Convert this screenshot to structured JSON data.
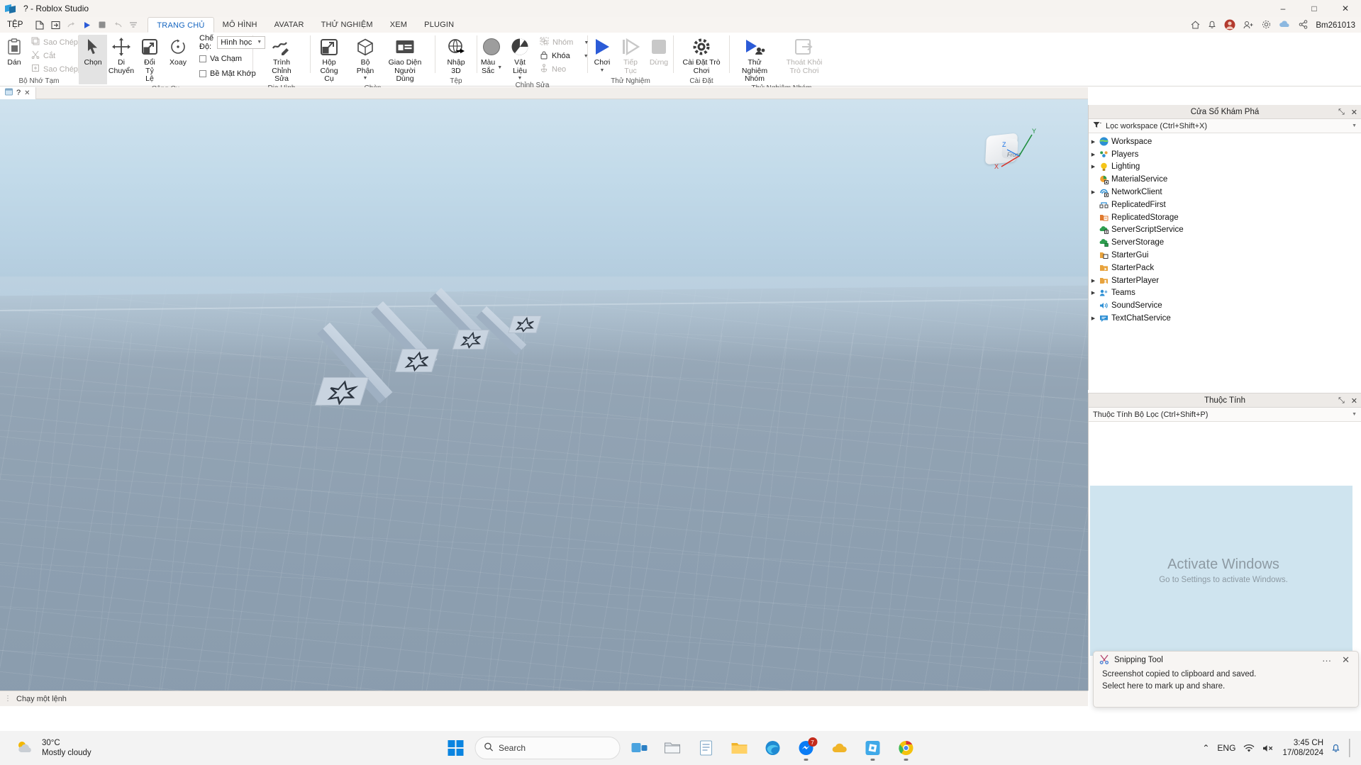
{
  "window": {
    "title": "? - Roblox Studio",
    "minimize": "–",
    "maximize": "□",
    "close": "✕"
  },
  "menu": {
    "file": "TỆP"
  },
  "quick_access": [
    {
      "name": "new-file-icon",
      "tooltip": "New"
    },
    {
      "name": "open-file-icon",
      "tooltip": "Open"
    },
    {
      "name": "redo-icon",
      "tooltip": "Redo"
    },
    {
      "name": "play-icon",
      "tooltip": "Play"
    },
    {
      "name": "stop-icon",
      "tooltip": "Stop"
    },
    {
      "name": "undo-icon",
      "tooltip": "Undo"
    },
    {
      "name": "customize-icon",
      "tooltip": "Customize"
    }
  ],
  "ribbon_tabs": [
    {
      "label": "TRANG CHỦ",
      "active": true
    },
    {
      "label": "MÔ HÌNH",
      "active": false
    },
    {
      "label": "AVATAR",
      "active": false
    },
    {
      "label": "THỬ NGHIỆM",
      "active": false
    },
    {
      "label": "XEM",
      "active": false
    },
    {
      "label": "PLUGIN",
      "active": false
    }
  ],
  "ribbon": {
    "groups": [
      {
        "label": "Bộ Nhớ Tạm",
        "paste": "Dán",
        "copy": "Sao Chép",
        "cut": "Cắt",
        "duplicate": "Sao Chép"
      },
      {
        "label": "Công Cụ",
        "select": "Chọn",
        "move": "Di Chuyển",
        "scale": "Đổi Tỷ\nLệ",
        "rotate": "Xoay",
        "mode_label": "Chế Độ:",
        "mode_value": "Hình học",
        "collisions": "Va Chạm",
        "join_surfaces": "Bề Mặt Khớp"
      },
      {
        "label": "Địa Hình",
        "editor": "Trình Chỉnh\nSửa"
      },
      {
        "label": "Chèn",
        "toolbox": "Hộp Công\nCụ",
        "part": "Bộ Phận",
        "ui": "Giao Diện\nNgười Dùng"
      },
      {
        "label": "Tệp",
        "import3d": "Nhập\n3D"
      },
      {
        "label": "Chỉnh Sửa",
        "color": "Màu\nSắc",
        "material": "Vật Liệu",
        "group": "Nhóm",
        "lock": "Khóa",
        "anchor": "Neo"
      },
      {
        "label": "Thử Nghiệm",
        "play": "Chơi",
        "resume": "Tiếp\nTục",
        "stop": "Dừng"
      },
      {
        "label": "Cài Đặt",
        "game_settings": "Cài Đặt Trò\nChơi"
      },
      {
        "label": "Thử Nghiệm Nhóm",
        "team_test": "Thử Nghiệm\nNhóm",
        "leave_game": "Thoát Khỏi\nTrò Chơi"
      }
    ]
  },
  "account_bar": {
    "user": "Bm261013",
    "icons": [
      "home-icon",
      "notification-bell-icon",
      "avatar-icon",
      "add-person-icon",
      "settings-gear-icon",
      "cloud-icon",
      "share-icon"
    ]
  },
  "viewport_tab": {
    "label": "?",
    "close": "✕"
  },
  "viewcube": {
    "front_label": "Front",
    "axis_x": "X",
    "axis_y": "Y",
    "axis_z": "Z",
    "color_x": "#d93025",
    "color_y": "#1e8e3e",
    "color_z": "#1a73e8"
  },
  "status_bar": {
    "command_placeholder": "Chạy một lệnh"
  },
  "explorer": {
    "title": "Cửa Sổ Khám Phá",
    "undock": "⤡",
    "close": "✕",
    "filter_placeholder": "Lọc workspace (Ctrl+Shift+X)",
    "filter_icon": "funnel-icon",
    "items": [
      {
        "label": "Workspace",
        "expandable": true,
        "icon": "workspace-globe-icon",
        "color": "#2d8fd4"
      },
      {
        "label": "Players",
        "expandable": true,
        "icon": "players-icon",
        "color": "#f0a030"
      },
      {
        "label": "Lighting",
        "expandable": true,
        "icon": "lighting-bulb-icon",
        "color": "#f5c518"
      },
      {
        "label": "MaterialService",
        "expandable": false,
        "icon": "material-service-icon",
        "color": "#f0a030"
      },
      {
        "label": "NetworkClient",
        "expandable": true,
        "icon": "network-client-icon",
        "color": "#2d8fd4"
      },
      {
        "label": "ReplicatedFirst",
        "expandable": false,
        "icon": "replicated-first-icon",
        "color": "#2d8fd4"
      },
      {
        "label": "ReplicatedStorage",
        "expandable": false,
        "icon": "replicated-storage-icon",
        "color": "#e07a2f"
      },
      {
        "label": "ServerScriptService",
        "expandable": false,
        "icon": "server-script-service-icon",
        "color": "#2e9e4f"
      },
      {
        "label": "ServerStorage",
        "expandable": false,
        "icon": "server-storage-icon",
        "color": "#2e9e4f"
      },
      {
        "label": "StarterGui",
        "expandable": false,
        "icon": "starter-gui-folder-icon",
        "color": "#e8a33d"
      },
      {
        "label": "StarterPack",
        "expandable": false,
        "icon": "starter-pack-folder-icon",
        "color": "#e8a33d"
      },
      {
        "label": "StarterPlayer",
        "expandable": true,
        "icon": "starter-player-folder-icon",
        "color": "#e8a33d"
      },
      {
        "label": "Teams",
        "expandable": true,
        "icon": "teams-icon",
        "color": "#2d8fd4"
      },
      {
        "label": "SoundService",
        "expandable": false,
        "icon": "sound-service-icon",
        "color": "#2d8fd4"
      },
      {
        "label": "TextChatService",
        "expandable": true,
        "icon": "text-chat-service-icon",
        "color": "#2d8fd4"
      }
    ]
  },
  "properties": {
    "title": "Thuộc Tính",
    "undock": "⤡",
    "close": "✕",
    "filter_placeholder": "Thuộc Tính Bộ Lọc (Ctrl+Shift+P)",
    "watermark_line1": "Activate Windows",
    "watermark_line2": "Go to Settings to activate Windows."
  },
  "toast": {
    "app": "Snipping Tool",
    "app_icon": "snipping-tool-icon",
    "more": "···",
    "close": "✕",
    "line1": "Screenshot copied to clipboard and saved.",
    "line2": "Select here to mark up and share."
  },
  "taskbar": {
    "weather_temp": "30°C",
    "weather_desc": "Mostly cloudy",
    "search_placeholder": "Search",
    "start_icon": "windows-start-icon",
    "apps": [
      {
        "name": "task-view-icon",
        "running": false,
        "badge": ""
      },
      {
        "name": "file-explorer-icon",
        "running": false,
        "badge": ""
      },
      {
        "name": "notepad-icon",
        "running": false,
        "badge": ""
      },
      {
        "name": "folder-icon",
        "running": false,
        "badge": ""
      },
      {
        "name": "edge-browser-icon",
        "running": false,
        "badge": ""
      },
      {
        "name": "messenger-icon",
        "running": true,
        "badge": "7"
      },
      {
        "name": "cloud-app-icon",
        "running": false,
        "badge": ""
      },
      {
        "name": "roblox-studio-icon",
        "running": true,
        "badge": ""
      },
      {
        "name": "chrome-browser-icon",
        "running": true,
        "badge": ""
      }
    ],
    "tray": {
      "chevron": "⌃",
      "language": "ENG",
      "wifi_icon": "wifi-icon",
      "volume_icon": "volume-muted-icon",
      "time": "3:45 CH",
      "date": "17/08/2024",
      "notification_icon": "notification-bell-icon",
      "desktop_icon": "show-desktop-icon"
    }
  }
}
